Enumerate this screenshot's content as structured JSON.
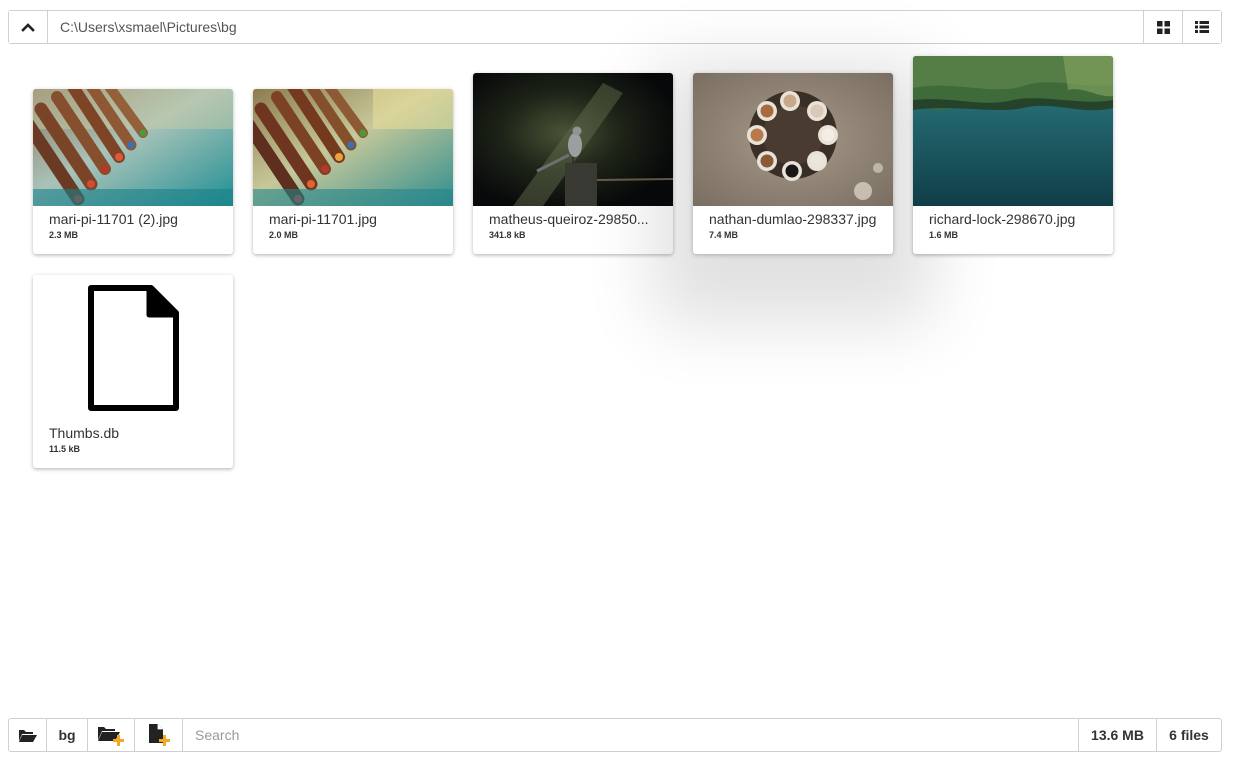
{
  "topbar": {
    "path": "C:\\Users\\xsmael\\Pictures\\bg",
    "up_icon": "chevron-up-icon",
    "grid_view_icon": "grid-view-icon",
    "list_view_icon": "list-view-icon"
  },
  "files": [
    {
      "name": "mari-pi-11701 (2).jpg",
      "size": "2.3 MB",
      "thumb": "pencils"
    },
    {
      "name": "mari-pi-11701.jpg",
      "size": "2.0 MB",
      "thumb": "pencils"
    },
    {
      "name": "matheus-queiroz-29850...",
      "size": "341.8 kB",
      "thumb": "bird"
    },
    {
      "name": "nathan-dumlao-298337.jpg",
      "size": "7.4 MB",
      "thumb": "coffee"
    },
    {
      "name": "richard-lock-298670.jpg",
      "size": "1.6 MB",
      "thumb": "lake"
    },
    {
      "name": "Thumbs.db",
      "size": "11.5 kB",
      "thumb": "file-icon"
    }
  ],
  "bottombar": {
    "open_folder_icon": "folder-open-icon",
    "folder_label": "bg",
    "new_folder_icon": "new-folder-icon",
    "new_file_icon": "new-file-icon",
    "search_placeholder": "Search",
    "total_size": "13.6 MB",
    "file_count": "6 files"
  },
  "colors": {
    "border": "#cfcfcf",
    "accent_plus": "#f5a623"
  }
}
